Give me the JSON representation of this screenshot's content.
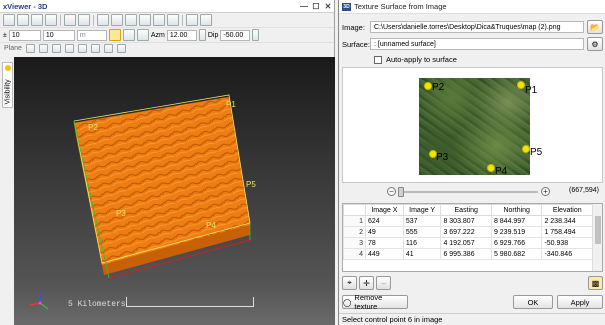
{
  "xviewer": {
    "title": "xViewer - 3D",
    "window_controls": [
      "—",
      "☐",
      "✕"
    ],
    "field_1": "10",
    "field_2": "10",
    "unit": "m",
    "azm_label": "Azm",
    "azm_value": "12.00",
    "dip_label": "Dip",
    "dip_value": "-50.00",
    "plane_label": "Plane",
    "visibility_tab": "Visibility",
    "scale_label": "5 Kilometers",
    "point_labels": [
      "P1",
      "P2",
      "P3",
      "P4",
      "P5"
    ],
    "colors": {
      "terrain": "#e8780a",
      "frame_yellow": "#e6e66a",
      "edge_red": "#cc2222",
      "edge_green": "#2fbf3a"
    }
  },
  "dialog": {
    "title": "Texture Surface from Image",
    "app_badge": "3D",
    "image_label": "Image:",
    "image_path": "C:\\Users\\danielle.torres\\Desktop\\Dica&Truques\\map (2).png",
    "surface_label": "Surface:",
    "surface_value": ": [unnamed surface]",
    "auto_apply_label": "Auto-apply to surface",
    "auto_apply_checked": false,
    "control_points": [
      {
        "label": "P1"
      },
      {
        "label": "P2"
      },
      {
        "label": "P3"
      },
      {
        "label": "P4"
      },
      {
        "label": "P5"
      }
    ],
    "coords_readout": "(667,594)",
    "table": {
      "headers": [
        "Image X",
        "Image Y",
        "Easting",
        "Northing",
        "Elevation"
      ],
      "rows": [
        {
          "n": "1",
          "cells": [
            "624",
            "537",
            "8 303.807",
            "8 844.997",
            "2 238.344"
          ]
        },
        {
          "n": "2",
          "cells": [
            "49",
            "555",
            "3 697.222",
            "9 239.519",
            "1 758.494"
          ]
        },
        {
          "n": "3",
          "cells": [
            "78",
            "116",
            "4 192.057",
            "6 929.766",
            "-50.938"
          ]
        },
        {
          "n": "4",
          "cells": [
            "449",
            "41",
            "6 995.386",
            "5 980.682",
            "-340.846"
          ]
        }
      ]
    },
    "remove_texture_label": "Remove texture",
    "ok_label": "OK",
    "apply_label": "Apply",
    "status": "Select control point 6 in image",
    "zoom_minus": "−",
    "zoom_plus": "+",
    "minus_btn": "–"
  }
}
